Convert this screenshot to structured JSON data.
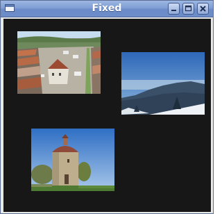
{
  "window": {
    "title": "Fixed",
    "buttons": [
      "minimize",
      "maximize",
      "close"
    ],
    "colors": {
      "titlebar": "#7f9ed6",
      "content_bg": "#171717"
    }
  },
  "photos": [
    {
      "subject": "town-square-aerial"
    },
    {
      "subject": "snowy-mountains"
    },
    {
      "subject": "round-stone-tower"
    }
  ]
}
